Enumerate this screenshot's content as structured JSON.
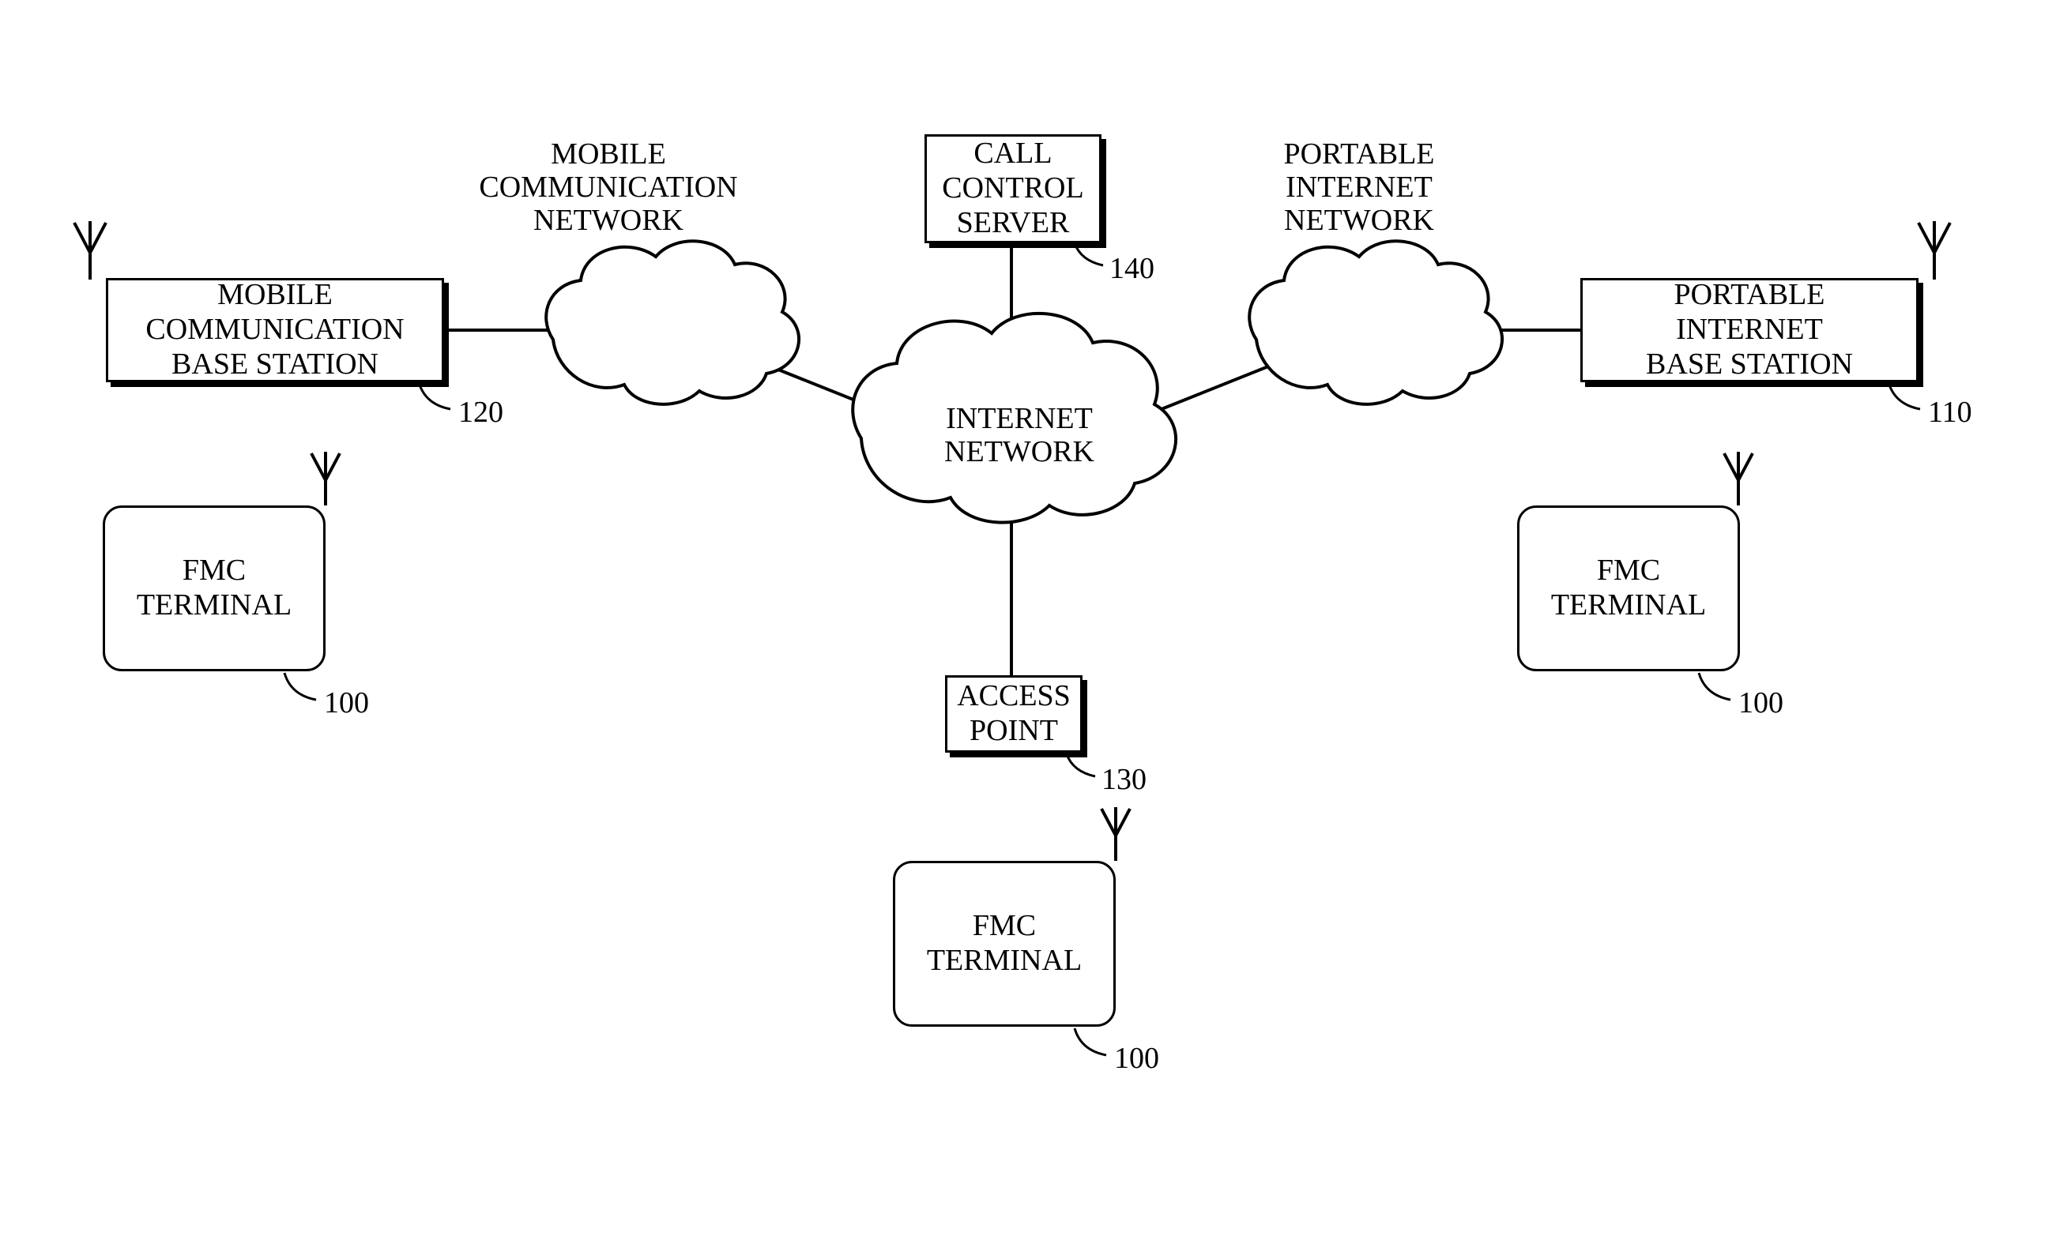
{
  "labels": {
    "mcn": "MOBILE\nCOMMUNICATION\nNETWORK",
    "pin": "PORTABLE\nINTERNET\nNETWORK",
    "inet": "INTERNET\nNETWORK",
    "ccs": "CALL\nCONTROL\nSERVER",
    "mcbs": "MOBILE\nCOMMUNICATION\nBASE STATION",
    "pibs": "PORTABLE\nINTERNET\nBASE STATION",
    "ap": "ACCESS\nPOINT",
    "fmc": "FMC\nTERMINAL"
  },
  "refs": {
    "r100": "100",
    "r110": "110",
    "r120": "120",
    "r130": "130",
    "r140": "140"
  }
}
